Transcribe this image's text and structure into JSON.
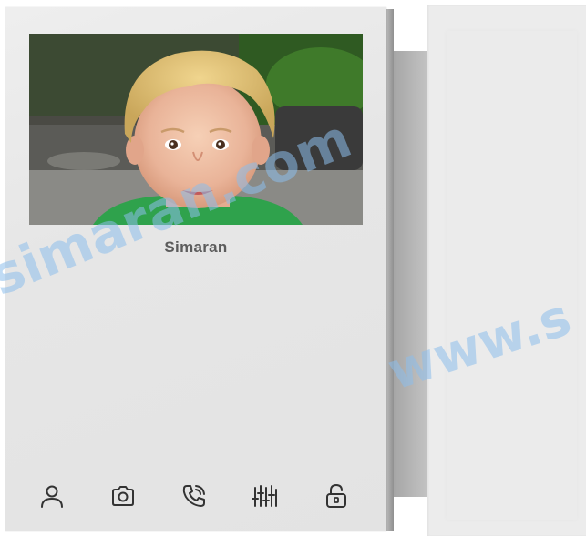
{
  "caller": {
    "name": "Simaran"
  },
  "watermark": {
    "left": "simaran.com",
    "right": "www.s"
  },
  "buttons": [
    {
      "id": "contacts",
      "icon": "user-icon"
    },
    {
      "id": "snapshot",
      "icon": "camera-icon"
    },
    {
      "id": "call",
      "icon": "phone-call-icon"
    },
    {
      "id": "settings",
      "icon": "equalizer-icon"
    },
    {
      "id": "unlock",
      "icon": "unlock-icon"
    }
  ],
  "colors": {
    "icon": "#333333",
    "body": "#e6e6e6",
    "watermark": "#8cbeeb"
  }
}
